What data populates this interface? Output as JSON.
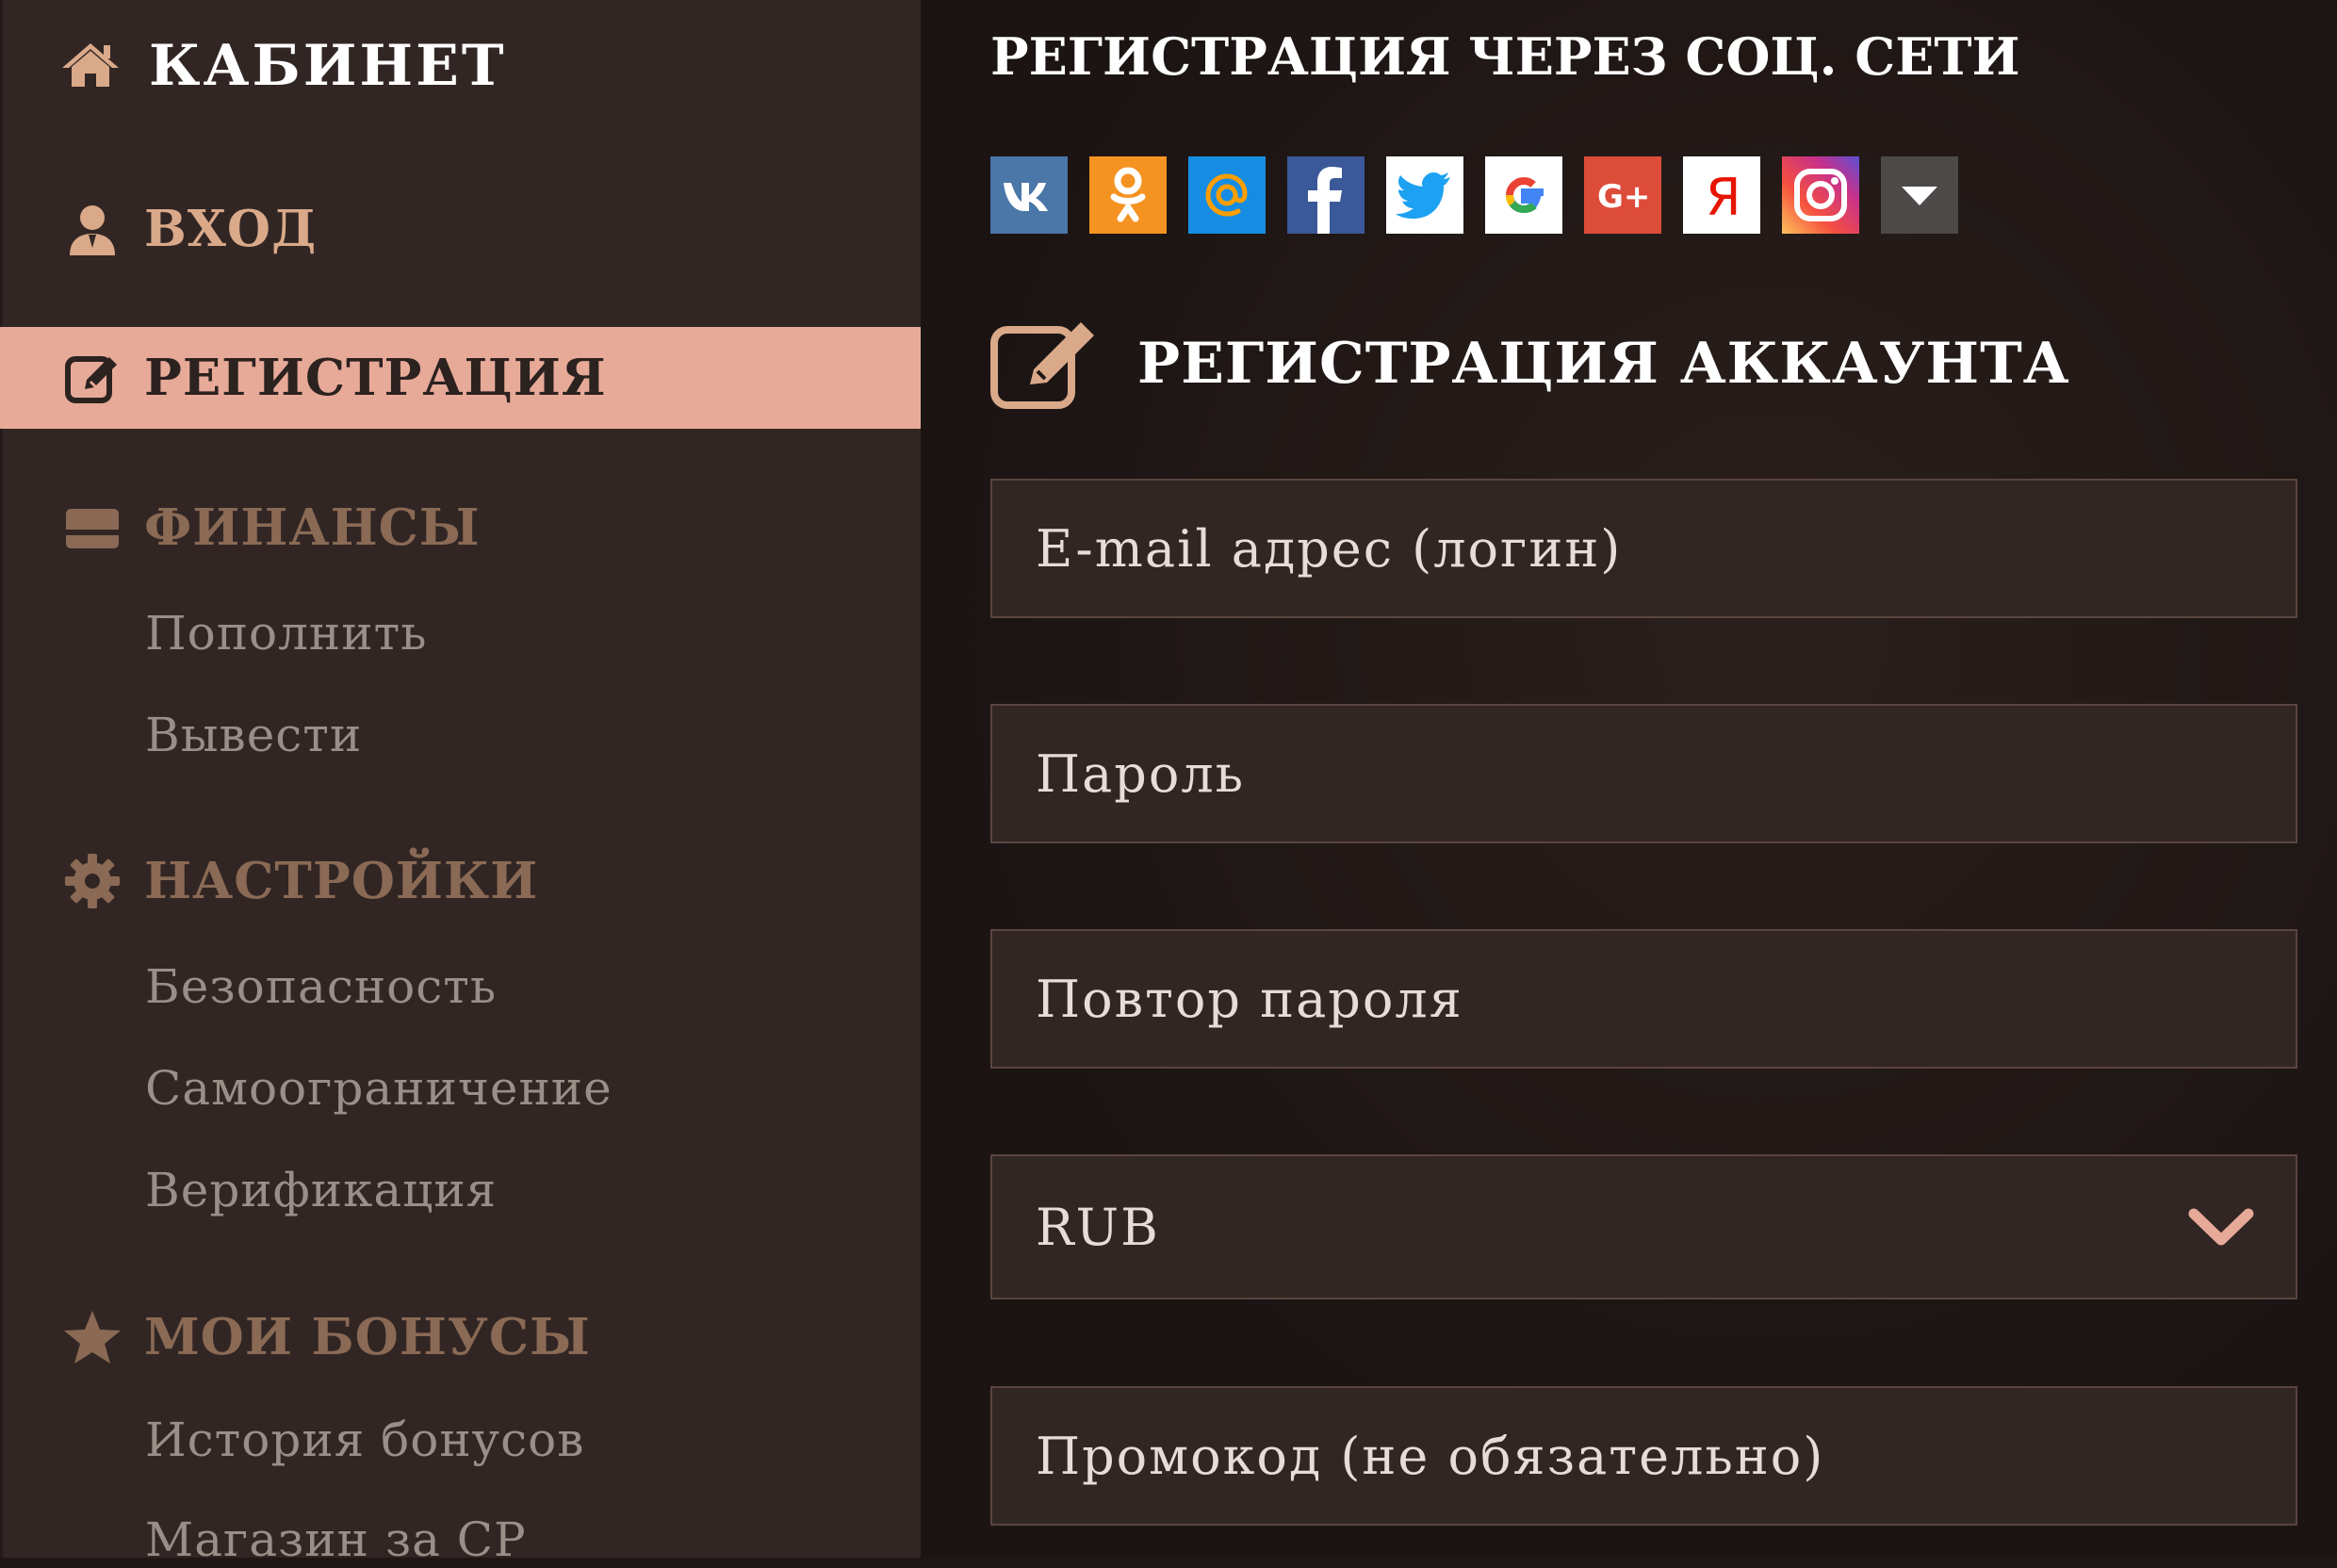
{
  "sidebar": {
    "brand": "КАБИНЕТ",
    "login": "ВХОД",
    "register": "РЕГИСТРАЦИЯ",
    "finance": {
      "title": "ФИНАНСЫ",
      "items": [
        "Пополнить",
        "Вывести"
      ]
    },
    "settings": {
      "title": "НАСТРОЙКИ",
      "items": [
        "Безопасность",
        "Самоограничение",
        "Верификация"
      ]
    },
    "bonuses": {
      "title": "МОИ БОНУСЫ",
      "items": [
        "История бонусов",
        "Магазин за CP"
      ]
    }
  },
  "main": {
    "social_title": "РЕГИСТРАЦИЯ ЧЕРЕЗ СОЦ. СЕТИ",
    "social_buttons": [
      "vk-icon",
      "odnoklassniki-icon",
      "mailru-icon",
      "facebook-icon",
      "twitter-icon",
      "google-icon",
      "google-plus-icon",
      "yandex-icon",
      "instagram-icon",
      "more-dropdown-icon"
    ],
    "register_title": "РЕГИСТРАЦИЯ АККАУНТА",
    "fields": {
      "email_placeholder": "E-mail адрес (логин)",
      "password_placeholder": "Пароль",
      "password_repeat_placeholder": "Повтор пароля",
      "currency_value": "RUB",
      "promo_placeholder": "Промокод (не обязательно)"
    }
  },
  "colors": {
    "sidebar_bg": "#322624",
    "active_bg": "#e7aa98",
    "accent": "#d9a989",
    "section_head": "#8a6a55",
    "sub_item": "#9a8f88"
  }
}
